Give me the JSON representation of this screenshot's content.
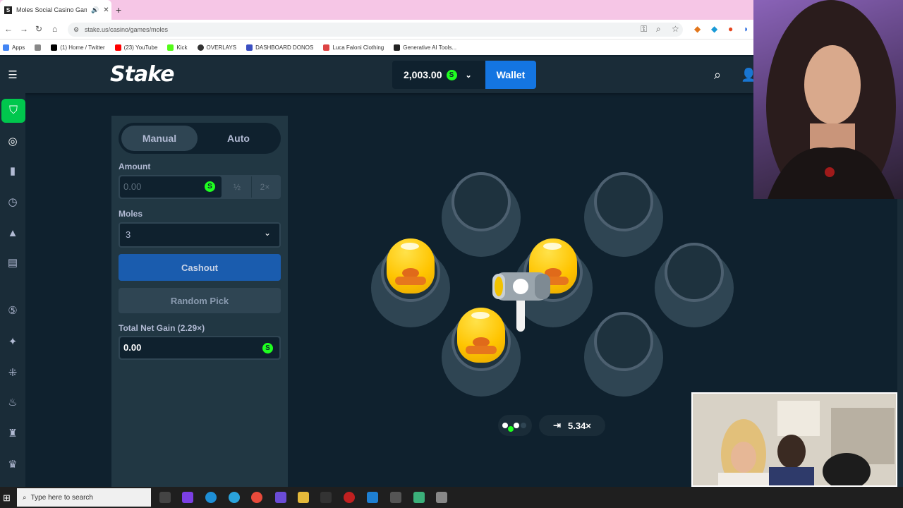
{
  "browser": {
    "tab_title": "Moles Social Casino Game",
    "tab_favicon": "S",
    "url": "stake.us/casino/games/moles",
    "bookmarks": [
      {
        "label": "Apps",
        "color": "#4285f4"
      },
      {
        "label": "",
        "color": "#888888"
      },
      {
        "label": "(1) Home / Twitter",
        "color": "#000000"
      },
      {
        "label": "(23) YouTube",
        "color": "#ff0000"
      },
      {
        "label": "Kick",
        "color": "#53fc18"
      },
      {
        "label": "OVERLAYS",
        "color": "#333333"
      },
      {
        "label": "DASHBOARD DONOS",
        "color": "#3a4fc2"
      },
      {
        "label": "Luca Faloni Clothing",
        "color": "#d44"
      },
      {
        "label": "Generative AI Tools...",
        "color": "#222222"
      }
    ]
  },
  "header": {
    "logo": "Stake",
    "balance": "2,003.00",
    "wallet_label": "Wallet"
  },
  "panel": {
    "manual_label": "Manual",
    "auto_label": "Auto",
    "amount_label": "Amount",
    "amount_value": "0.00",
    "half_label": "½",
    "double_label": "2×",
    "moles_label": "Moles",
    "moles_value": "3",
    "cashout_label": "Cashout",
    "random_label": "Random Pick",
    "gain_label": "Total Net Gain (2.29×)",
    "gain_value": "0.00",
    "coin_symbol": "S"
  },
  "game": {
    "multiplier": "5.34×"
  },
  "taskbar": {
    "search_placeholder": "Type here to search"
  },
  "colors": {
    "accent_green": "#00c74d",
    "wallet_blue": "#1475e1",
    "coin_green": "#1fff20",
    "background": "#0f212e"
  }
}
